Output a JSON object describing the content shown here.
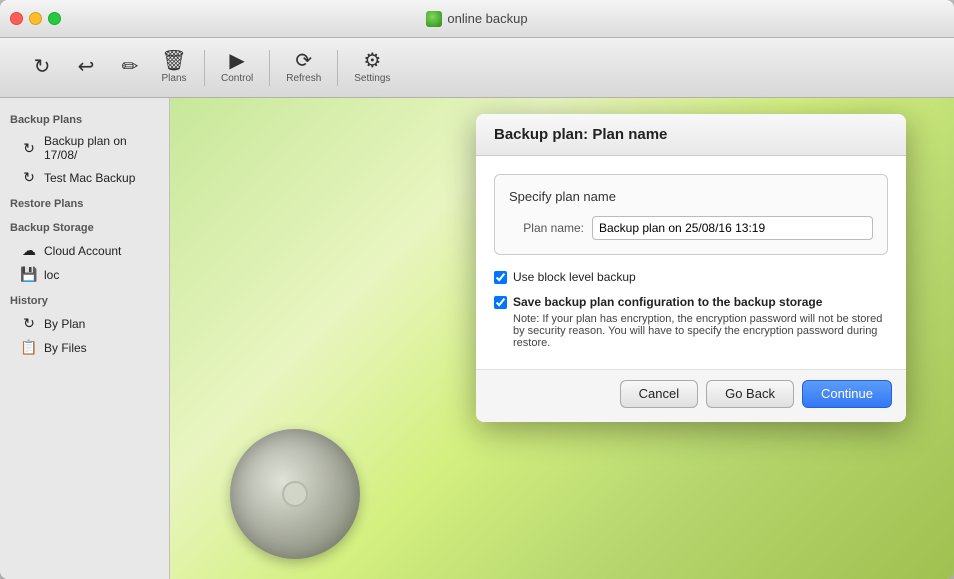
{
  "window": {
    "title": "online backup",
    "controls": {
      "close": "close",
      "minimize": "minimize",
      "maximize": "maximize"
    }
  },
  "toolbar": {
    "items": [
      {
        "id": "plans",
        "icon": "↻",
        "label": "Plans"
      },
      {
        "id": "control",
        "icon": "↩",
        "label": "Control"
      },
      {
        "id": "refresh",
        "icon": "⟳",
        "label": "Refresh"
      },
      {
        "id": "settings",
        "icon": "⚙",
        "label": "Settings"
      }
    ]
  },
  "sidebar": {
    "sections": [
      {
        "label": "Backup Plans",
        "items": [
          {
            "id": "backup-plan-1",
            "icon": "↻",
            "label": "Backup plan on 17/08/"
          },
          {
            "id": "test-mac-backup",
            "icon": "↻",
            "label": "Test Mac Backup"
          }
        ]
      },
      {
        "label": "Restore Plans",
        "items": []
      },
      {
        "label": "Backup Storage",
        "items": [
          {
            "id": "cloud-account",
            "icon": "☁",
            "label": "Cloud Account"
          },
          {
            "id": "loc",
            "icon": "💾",
            "label": "loc"
          }
        ]
      },
      {
        "label": "History",
        "items": [
          {
            "id": "by-plan",
            "icon": "↻",
            "label": "By Plan"
          },
          {
            "id": "by-files",
            "icon": "📋",
            "label": "By Files"
          }
        ]
      }
    ]
  },
  "dialog": {
    "title": "Backup plan: Plan name",
    "spec_section_title": "Specify plan name",
    "plan_name_label": "Plan name:",
    "plan_name_value": "Backup plan on 25/08/16 13:19",
    "plan_name_placeholder": "Backup plan on 25/08/16 13:19",
    "checkbox_block_level_label": "Use block level backup",
    "checkbox_block_level_checked": true,
    "checkbox_save_config_label": "Save backup plan configuration to the backup storage",
    "checkbox_save_config_checked": true,
    "checkbox_save_config_note": "Note: If your plan has encryption, the encryption password will not be stored by security reason. You will have to specify the encryption password during restore.",
    "buttons": {
      "cancel": "Cancel",
      "go_back": "Go Back",
      "continue": "Continue"
    }
  }
}
